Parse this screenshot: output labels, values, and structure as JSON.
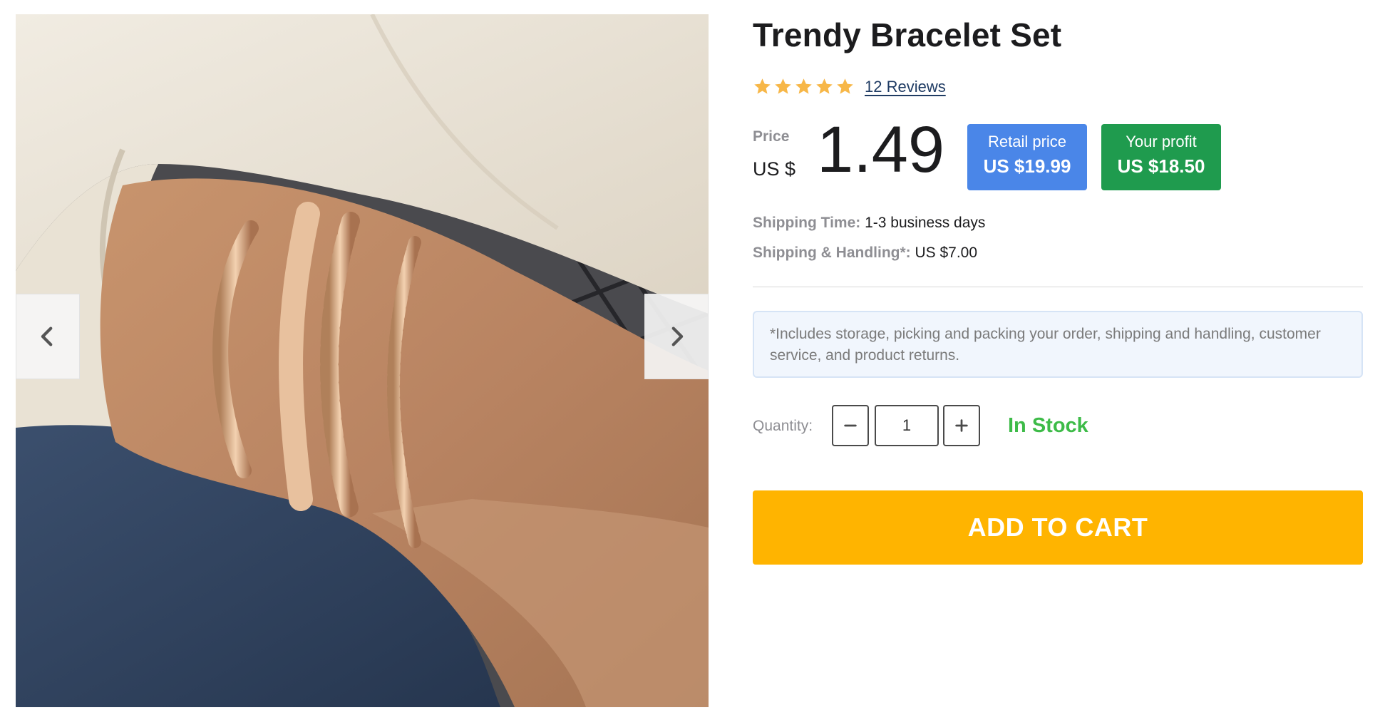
{
  "product": {
    "title": "Trendy Bracelet Set",
    "rating_stars": 5,
    "reviews_label": "12 Reviews"
  },
  "price": {
    "label": "Price",
    "currency": "US $",
    "value": "1.49"
  },
  "badges": {
    "retail_label": "Retail price",
    "retail_value": "US $19.99",
    "profit_label": "Your profit",
    "profit_value": "US $18.50"
  },
  "shipping": {
    "time_label": "Shipping Time:",
    "time_value": "1-3 business days",
    "handling_label": "Shipping & Handling*:",
    "handling_value": "US $7.00"
  },
  "notice": "*Includes storage, picking and packing your order, shipping and handling, customer service, and product returns.",
  "quantity": {
    "label": "Quantity:",
    "value": "1"
  },
  "stock_status": "In Stock",
  "add_to_cart_label": "ADD TO CART",
  "gallery": {
    "prev_icon": "chevron-left-icon",
    "next_icon": "chevron-right-icon"
  },
  "colors": {
    "star": "#f7b748",
    "retail_badge": "#4a86e8",
    "profit_badge": "#1f9b4e",
    "in_stock": "#3dbb48",
    "add_to_cart": "#ffb400"
  }
}
